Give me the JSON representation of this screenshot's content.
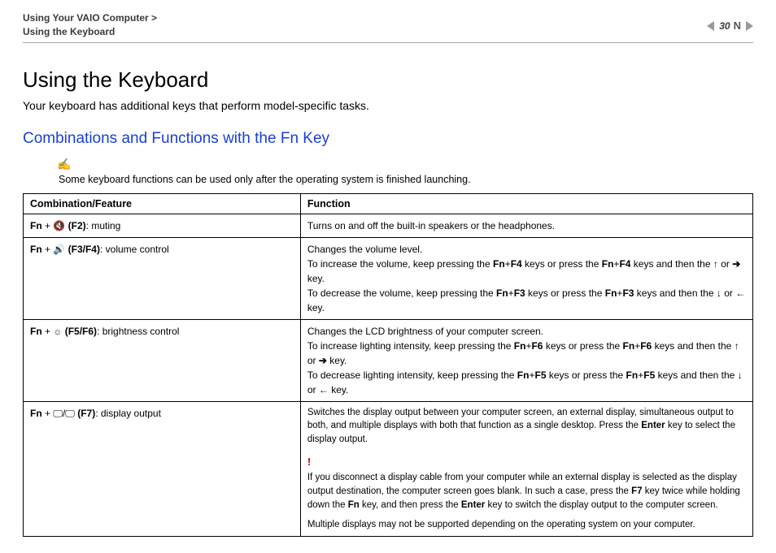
{
  "header": {
    "breadcrumb_line1": "Using Your VAIO Computer",
    "breadcrumb_sep": ">",
    "breadcrumb_line2": "Using the Keyboard",
    "page_number": "30",
    "n_label": "N"
  },
  "content": {
    "h1": "Using the Keyboard",
    "intro": "Your keyboard has additional keys that perform model-specific tasks.",
    "h2": "Combinations and Functions with the Fn Key",
    "note_icon": "✍",
    "note_text": "Some keyboard functions can be used only after the operating system is finished launching."
  },
  "table": {
    "th1": "Combination/Feature",
    "th2": "Function",
    "rows": {
      "r1": {
        "fnplus": "Fn",
        "plus": " + ",
        "sym": "🔇",
        "key": " (F2)",
        "desc": ": muting",
        "func": "Turns on and off the built-in speakers or the headphones."
      },
      "r2": {
        "fnplus": "Fn",
        "plus": " + ",
        "sym": "🔊",
        "key": " (F3/F4)",
        "desc": ": volume control",
        "func_l1": "Changes the volume level.",
        "func_l2a": "To increase the volume, keep pressing the ",
        "k_fn": "Fn",
        "k_plus": "+",
        "k_f4": "F4",
        "func_l2b": " keys or press the ",
        "func_l2c": " keys and then the ",
        "arrow_up": "↑",
        "or": " or ",
        "arrow_right": "➔",
        "key_word": " key.",
        "func_l3a": "To decrease the volume, keep pressing the ",
        "k_f3": "F3",
        "func_l3b": " keys or press the ",
        "func_l3c": " keys and then the ",
        "arrow_down": "↓",
        "arrow_left": "←"
      },
      "r3": {
        "fnplus": "Fn",
        "plus": " + ",
        "sym": "☼",
        "key": " (F5/F6)",
        "desc": ": brightness control",
        "func_l1": "Changes the LCD brightness of your computer screen.",
        "func_l2a": "To increase lighting intensity, keep pressing the ",
        "k_f6": "F6",
        "func_l2b": " keys or press the ",
        "func_l2c": " keys and then the ",
        "func_l3a": "To decrease lighting intensity, keep pressing the ",
        "k_f5": "F5"
      },
      "r4": {
        "fnplus": "Fn",
        "plus": " + ",
        "sym1": "🖵",
        "slash": "/",
        "sym2": "🖵",
        "key": " (F7)",
        "desc": ": display output",
        "func_p1a": "Switches the display output between your computer screen, an external display, simultaneous output to both, and multiple displays with both that function as a single desktop. Press the ",
        "k_enter": "Enter",
        "func_p1b": " key to select the display output.",
        "bang": "!",
        "func_p2a": "If you disconnect a display cable from your computer while an external display is selected as the display output destination, the computer screen goes blank. In such a case, press the ",
        "k_f7": "F7",
        "func_p2b": " key twice while holding down the ",
        "k_fn": "Fn",
        "func_p2c": " key, and then press the ",
        "func_p2d": " key to switch the display output to the computer screen.",
        "func_p3": "Multiple displays may not be supported depending on the operating system on your computer."
      }
    }
  }
}
